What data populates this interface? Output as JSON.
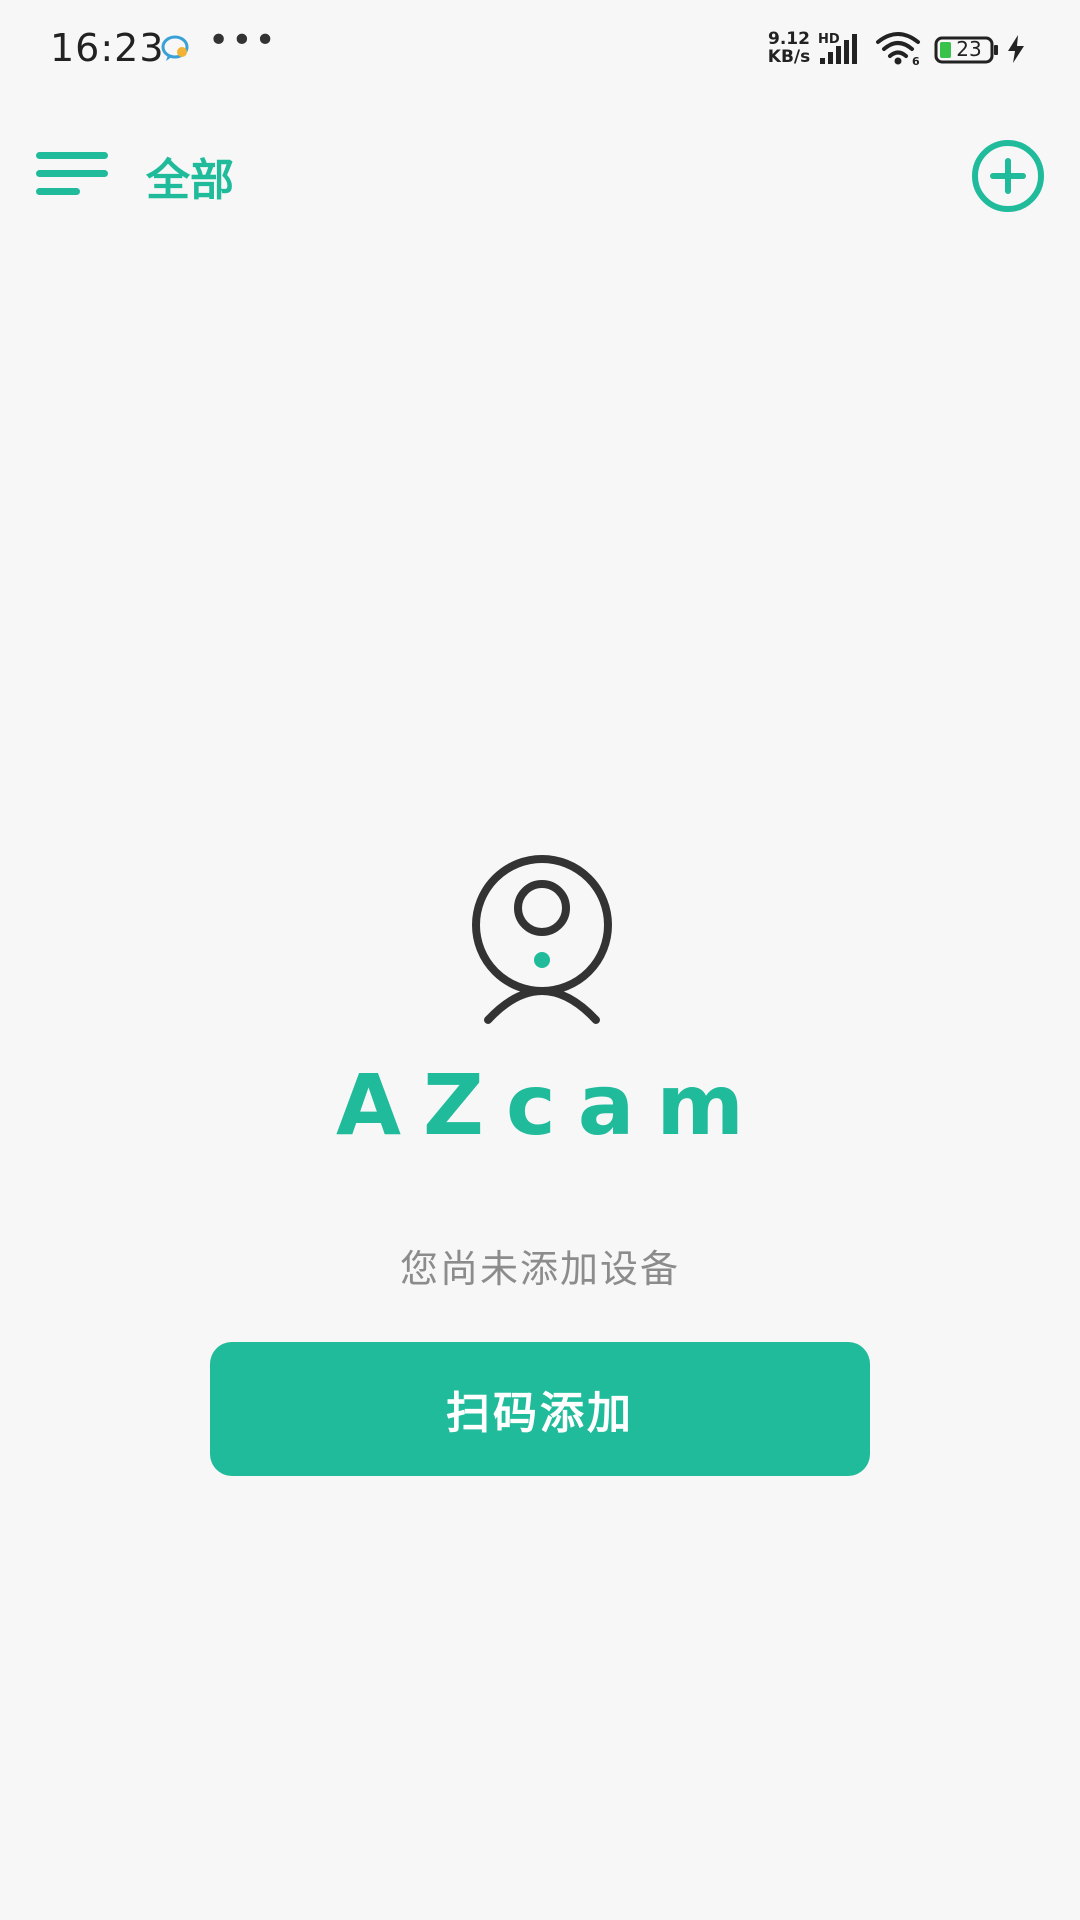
{
  "status_bar": {
    "time": "16:23",
    "more": "•••",
    "net_speed_value": "9.12",
    "net_speed_unit": "KB/s",
    "hd": "HD",
    "battery": "23",
    "icons": [
      "message-bubble-icon",
      "signal-icon",
      "wifi-icon",
      "battery-icon",
      "charging-icon"
    ]
  },
  "header": {
    "title": "全部",
    "menu_icon": "menu-icon",
    "add_icon": "add-circle-icon"
  },
  "empty_state": {
    "logo_icon": "camera-person-icon",
    "brand": "AZcam",
    "message": "您尚未添加设备",
    "button_label": "扫码添加"
  },
  "colors": {
    "accent": "#1fbb9a",
    "background": "#f7f7f7",
    "icon_dark": "#333333",
    "message_text": "#8c8c8c"
  }
}
